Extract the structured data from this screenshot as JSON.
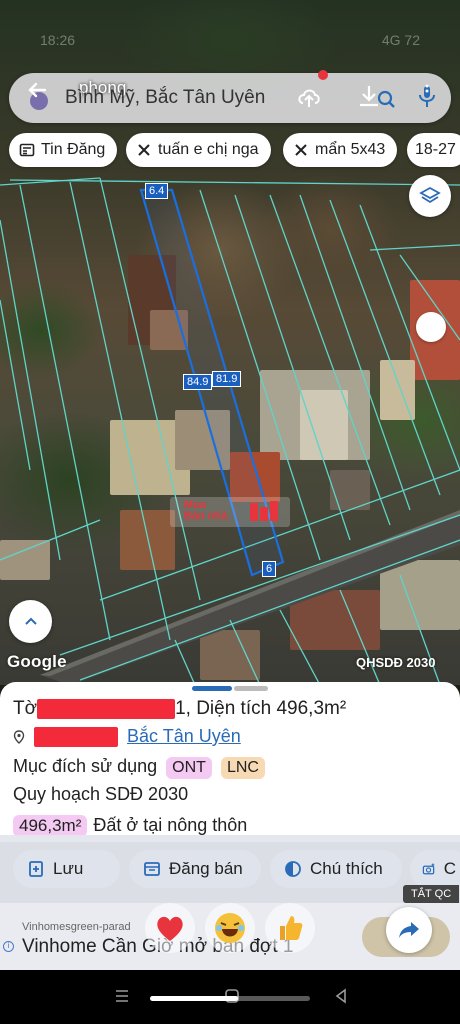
{
  "status_bar": {
    "time": "18:26",
    "system": "4G 72"
  },
  "search": {
    "username": "phong",
    "query": "Bình Mỹ, Bắc Tân Uyên"
  },
  "chips": [
    {
      "label": "Tin Đăng",
      "icon": "newspaper-icon"
    },
    {
      "label": "tuấn e chị nga",
      "icon": "ruler-icon"
    },
    {
      "label": "mẩn 5x43",
      "icon": "ruler-icon"
    },
    {
      "label": "18-27",
      "icon": ""
    }
  ],
  "map": {
    "dimension_labels": {
      "top": "6.4",
      "left_side": "84.9",
      "right_side": "81.9",
      "bottom": "6"
    },
    "watermark": {
      "line1": "Mua",
      "line2": "Bán nhà"
    },
    "attribution": "Google",
    "layer_label": "QHSDĐ 2030"
  },
  "sheet": {
    "title_prefix": "Tờ",
    "title_suffix": "1, Diện tích 496,3m²",
    "location_suffix": "Bắc Tân Uyên",
    "purpose_label": "Mục đích sử dụng",
    "purpose_tags": [
      "ONT",
      "LNC"
    ],
    "planning_label": "Quy hoạch SDĐ 2030",
    "planning_area": "496,3m²",
    "planning_desc": "Đất ở tại nông thôn"
  },
  "actions": [
    {
      "label": "Lưu",
      "icon": "bookmark-plus-icon"
    },
    {
      "label": "Đăng bán",
      "icon": "listing-icon"
    },
    {
      "label": "Chú thích",
      "icon": "contrast-icon"
    },
    {
      "label": "C",
      "icon": "camera-plus-icon"
    }
  ],
  "ad": {
    "hide_label": "TẮT QC",
    "url": "Vinhomesgreen-parad",
    "title": "Vinhome Cần Giờ mở bán đợt 1",
    "reactions": [
      "heart-icon",
      "laughing-face-icon",
      "thumbs-up-icon"
    ]
  },
  "colors": {
    "plot_line": "#5fd4c8",
    "plot_highlight": "#1a6fe0",
    "accent_red": "#e8353d",
    "tag_pink": "#f4c9f2",
    "tag_orange": "#f7d9b4"
  },
  "progress": 0.55
}
